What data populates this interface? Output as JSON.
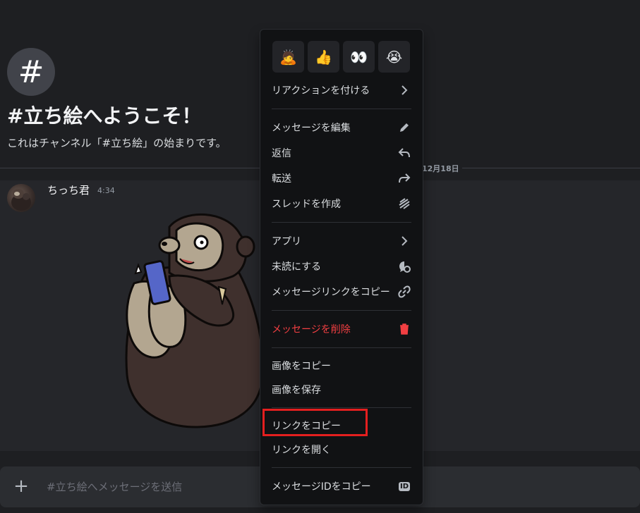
{
  "channel": {
    "hash_symbol": "#",
    "welcome_title": "#立ち絵へようこそ！",
    "welcome_subtitle": "これはチャンネル「#立ち絵」の始まりです。",
    "date_label": "12月18日"
  },
  "message": {
    "author": "ちっち君",
    "time": "4:34"
  },
  "input": {
    "plus": "+",
    "placeholder": "#立ち絵へメッセージを送信"
  },
  "context_menu": {
    "reactions": [
      "🙇",
      "👍",
      "👀",
      "😭"
    ],
    "items": {
      "add_reaction": "リアクションを付ける",
      "edit_message": "メッセージを編集",
      "reply": "返信",
      "forward": "転送",
      "create_thread": "スレッドを作成",
      "apps": "アプリ",
      "mark_unread": "未読にする",
      "copy_message_link": "メッセージリンクをコピー",
      "delete_message": "メッセージを削除",
      "copy_image": "画像をコピー",
      "save_image": "画像を保存",
      "copy_link": "リンクをコピー",
      "open_link": "リンクを開く",
      "copy_message_id": "メッセージIDをコピー"
    },
    "id_badge": "ID"
  },
  "colors": {
    "background": "#1e1f22",
    "menu_background": "#111214",
    "danger": "#f23f42",
    "highlight": "#e41f1f"
  }
}
